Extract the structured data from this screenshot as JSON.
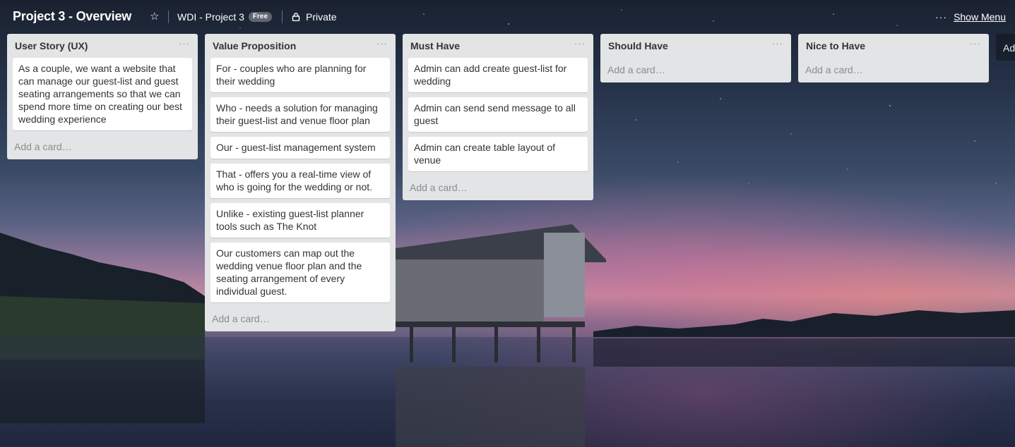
{
  "board": {
    "title": "Project 3 - Overview",
    "star_icon": "star-icon",
    "team": "WDI - Project 3",
    "team_badge": "Free",
    "visibility": "Private",
    "visibility_icon": "lock-icon",
    "menu_icon": "more-dots-icon",
    "show_menu": "Show Menu"
  },
  "lists": [
    {
      "title": "User Story (UX)",
      "menu": "···",
      "cards": [
        "As a couple, we want a website that can manage our guest-list and guest seating arrangements so that we can spend more time on creating our best wedding experience"
      ],
      "add_card": "Add a card…"
    },
    {
      "title": "Value Proposition",
      "menu": "···",
      "cards": [
        "For - couples who are planning for their wedding",
        "Who - needs a solution for managing their guest-list and venue floor plan",
        "Our - guest-list management system",
        "That - offers you a real-time view of who is going for the wedding or not.",
        "Unlike - existing guest-list planner tools such as The Knot",
        "Our customers can map out the wedding venue floor plan and the seating arrangement of every individual guest."
      ],
      "add_card": "Add a card…"
    },
    {
      "title": "Must Have",
      "menu": "···",
      "cards": [
        "Admin can add create guest-list for wedding",
        "Admin can send send message to all guest",
        "Admin can create table layout of venue"
      ],
      "add_card": "Add a card…"
    },
    {
      "title": "Should Have",
      "menu": "···",
      "cards": [],
      "add_card": "Add a card…"
    },
    {
      "title": "Nice to Have",
      "menu": "···",
      "cards": [],
      "add_card": "Add a card…"
    }
  ],
  "add_list": "Add a list…",
  "colors": {
    "list_bg": "#e2e4e6",
    "card_bg": "#ffffff",
    "header_text": "#ffffff",
    "muted_text": "#8c8c8c"
  }
}
